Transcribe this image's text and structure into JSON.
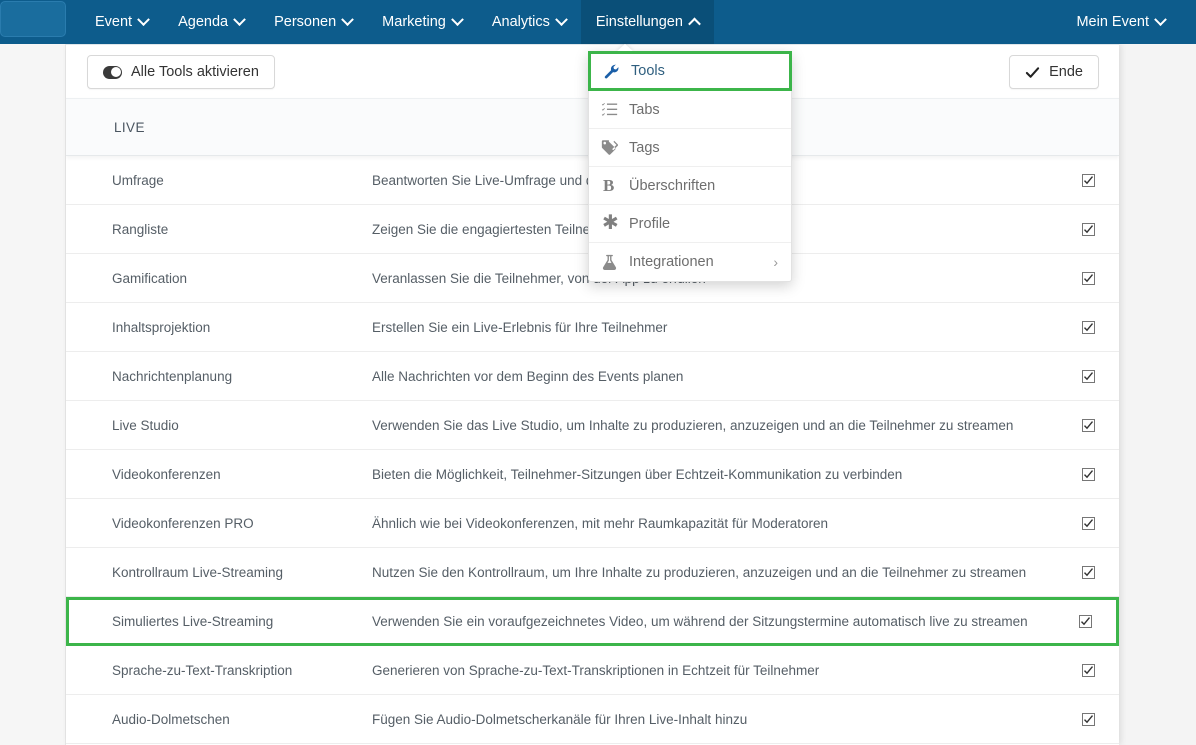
{
  "colors": {
    "navbar": "#0d5c8c",
    "navbar_active": "#0a4f78",
    "accent_green": "#3cb54a",
    "icon_blue": "#1b5fa8",
    "panel_bg": "#ffffff"
  },
  "topnav": {
    "items": [
      {
        "label": "Event",
        "icon": "chevron-down-icon",
        "active": false
      },
      {
        "label": "Agenda",
        "icon": "chevron-down-icon",
        "active": false
      },
      {
        "label": "Personen",
        "icon": "chevron-down-icon",
        "active": false
      },
      {
        "label": "Marketing",
        "icon": "chevron-down-icon",
        "active": false
      },
      {
        "label": "Analytics",
        "icon": "chevron-down-icon",
        "active": false
      },
      {
        "label": "Einstellungen",
        "icon": "chevron-up-icon",
        "active": true
      }
    ],
    "right": {
      "label": "Mein Event",
      "icon": "chevron-down-icon"
    }
  },
  "dropdown": {
    "items": [
      {
        "label": "Tools",
        "icon": "wrench-icon",
        "selected": true,
        "has_submenu": false
      },
      {
        "label": "Tabs",
        "icon": "list-checklist-icon",
        "selected": false,
        "has_submenu": false
      },
      {
        "label": "Tags",
        "icon": "tag-icon",
        "selected": false,
        "has_submenu": false
      },
      {
        "label": "Überschriften",
        "icon": "bold-b-icon",
        "selected": false,
        "has_submenu": false
      },
      {
        "label": "Profile",
        "icon": "asterisk-icon",
        "selected": false,
        "has_submenu": false
      },
      {
        "label": "Integrationen",
        "icon": "flask-icon",
        "selected": false,
        "has_submenu": true,
        "submenu_chevron": "›"
      }
    ]
  },
  "toolbar": {
    "toggle_all_label": "Alle Tools aktivieren",
    "toggle_all_icon": "toggle-switch-icon",
    "end_label": "Ende",
    "end_icon": "check-icon"
  },
  "section": {
    "title": "LIVE"
  },
  "table": {
    "rows": [
      {
        "name": "Umfrage",
        "description": "Beantworten Sie Live-Umfrage und dynamische Aktivitäten",
        "checked": true,
        "highlighted": false
      },
      {
        "name": "Rangliste",
        "description": "Zeigen Sie die engagiertesten Teilnehmer",
        "checked": true,
        "highlighted": false
      },
      {
        "name": "Gamification",
        "description": "Veranlassen Sie die Teilnehmer, von der App zu erfüllen",
        "checked": true,
        "highlighted": false
      },
      {
        "name": "Inhaltsprojektion",
        "description": "Erstellen Sie ein Live-Erlebnis für Ihre Teilnehmer",
        "checked": true,
        "highlighted": false
      },
      {
        "name": "Nachrichtenplanung",
        "description": "Alle Nachrichten vor dem Beginn des Events planen",
        "checked": true,
        "highlighted": false
      },
      {
        "name": "Live Studio",
        "description": "Verwenden Sie das Live Studio, um Inhalte zu produzieren, anzuzeigen und an die Teilnehmer zu streamen",
        "checked": true,
        "highlighted": false
      },
      {
        "name": "Videokonferenzen",
        "description": "Bieten die Möglichkeit, Teilnehmer-Sitzungen über Echtzeit-Kommunikation zu verbinden",
        "checked": true,
        "highlighted": false
      },
      {
        "name": "Videokonferenzen PRO",
        "description": "Ähnlich wie bei Videokonferenzen, mit mehr Raumkapazität für Moderatoren",
        "checked": true,
        "highlighted": false
      },
      {
        "name": "Kontrollraum Live-Streaming",
        "description": "Nutzen Sie den Kontrollraum, um Ihre Inhalte zu produzieren, anzuzeigen und an die Teilnehmer zu streamen",
        "checked": true,
        "highlighted": false
      },
      {
        "name": "Simuliertes Live-Streaming",
        "description": "Verwenden Sie ein voraufgezeichnetes Video, um während der Sitzungstermine automatisch live zu streamen",
        "checked": true,
        "highlighted": true
      },
      {
        "name": "Sprache-zu-Text-Transkription",
        "description": "Generieren von Sprache-zu-Text-Transkriptionen in Echtzeit für Teilnehmer",
        "checked": true,
        "highlighted": false
      },
      {
        "name": "Audio-Dolmetschen",
        "description": "Fügen Sie Audio-Dolmetscherkanäle für Ihren Live-Inhalt hinzu",
        "checked": true,
        "highlighted": false
      }
    ]
  }
}
